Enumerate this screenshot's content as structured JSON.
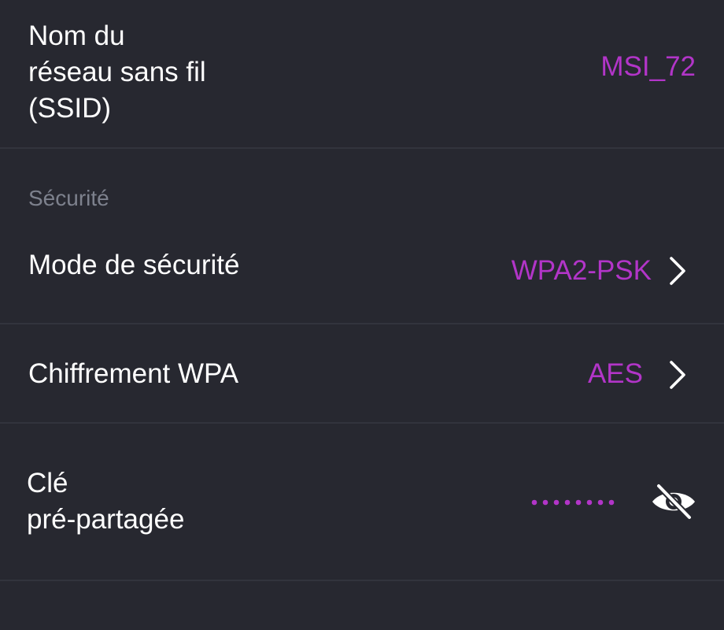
{
  "wifi": {
    "ssid_label": [
      "Nom du",
      "réseau sans fil",
      "(SSID)"
    ],
    "ssid_value": "MSI_72"
  },
  "security": {
    "section_title": "Sécurité",
    "mode_label": "Mode de sécurité",
    "mode_value": "WPA2-PSK",
    "encryption_label": "Chiffrement WPA",
    "encryption_value": "AES",
    "psk_label": [
      "Clé",
      "pré-partagée"
    ],
    "psk_masked": true,
    "psk_mask_dots": 8
  },
  "colors": {
    "background": "#272830",
    "accent": "#b235c8",
    "text": "#ffffff",
    "section_header": "#7d818d",
    "divider": "#32343d"
  },
  "icons": {
    "chevron": "chevron-right-icon",
    "visibility": "eye-off-icon"
  }
}
